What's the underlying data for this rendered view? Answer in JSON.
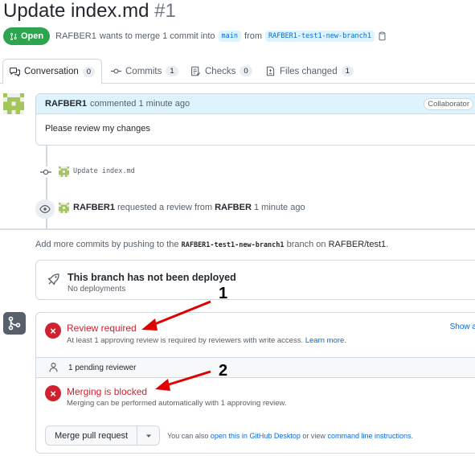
{
  "header": {
    "title": "Update index.md",
    "number": "#1",
    "state_label": "Open",
    "author": "RAFBER1",
    "merge_text_pre": "wants to merge 1 commit into",
    "base_branch": "main",
    "from_text": "from",
    "head_branch": "RAFBER1-test1-new-branch1"
  },
  "tabs": [
    {
      "label": "Conversation",
      "count": "0",
      "icon": "comment-discussion-icon"
    },
    {
      "label": "Commits",
      "count": "1",
      "icon": "git-commit-icon"
    },
    {
      "label": "Checks",
      "count": "0",
      "icon": "checklist-icon"
    },
    {
      "label": "Files changed",
      "count": "1",
      "icon": "file-diff-icon"
    }
  ],
  "comment": {
    "author": "RAFBER1",
    "meta": "commented 1 minute ago",
    "badge": "Collaborator",
    "body": "Please review my changes"
  },
  "timeline": {
    "commit_message": "Update index.md",
    "review_actor": "RAFBER1",
    "review_text": "requested a review from",
    "reviewer": "RAFBER",
    "review_time": "1 minute ago"
  },
  "push_note": {
    "pre": "Add more commits by pushing to the",
    "branch": "RAFBER1-test1-new-branch1",
    "mid": "branch on",
    "repo": "RAFBER/test1",
    "end": "."
  },
  "deploy": {
    "title": "This branch has not been deployed",
    "subtitle": "No deployments"
  },
  "merge": {
    "review_title": "Review required",
    "review_sub": "At least 1 approving review is required by reviewers with write access.",
    "learn_more": "Learn more.",
    "show_all": "Show a",
    "pending": "1 pending reviewer",
    "blocked_title": "Merging is blocked",
    "blocked_sub": "Merging can be performed automatically with 1 approving review.",
    "button_label": "Merge pull request",
    "note_pre": "You can also",
    "desktop_link": "open this in GitHub Desktop",
    "note_mid": "or view",
    "cli_link": "command line instructions",
    "note_end": "."
  },
  "annotations": [
    "1",
    "2"
  ],
  "colors": {
    "open_green": "#2da44e",
    "error_red": "#cf222e",
    "arrow_red": "#e00000",
    "link_blue": "#0969da"
  }
}
